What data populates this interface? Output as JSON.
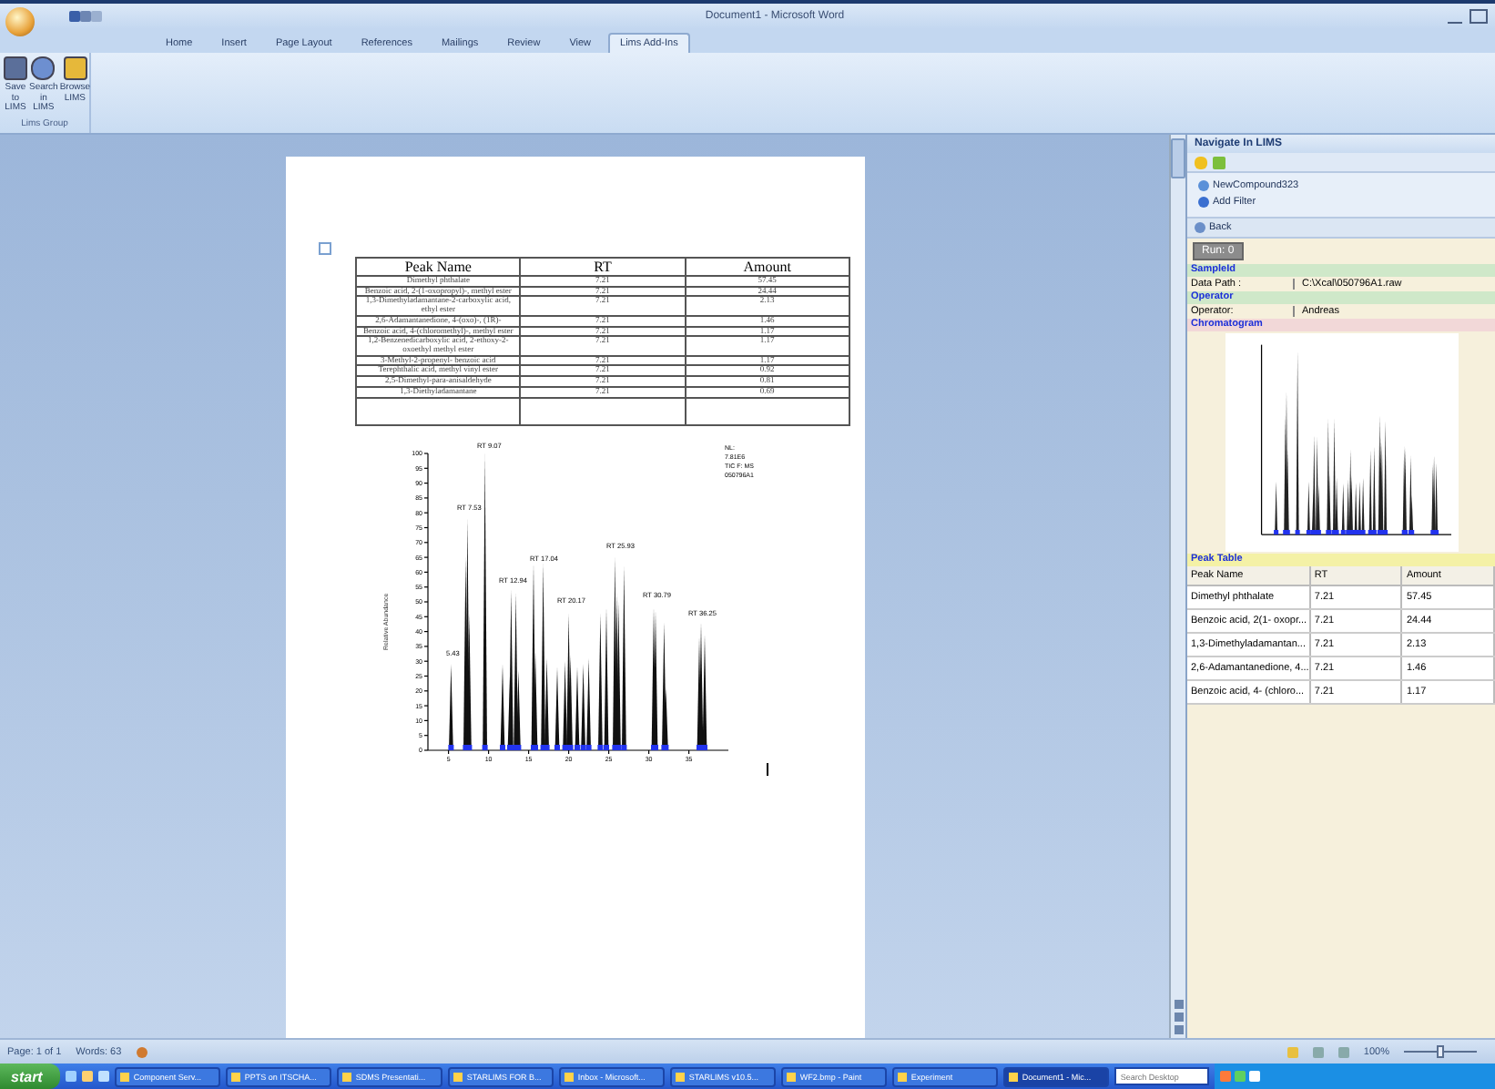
{
  "window": {
    "title": "Document1 - Microsoft Word"
  },
  "ribbon_tabs": [
    {
      "label": "Home",
      "selected": false
    },
    {
      "label": "Insert",
      "selected": false
    },
    {
      "label": "Page Layout",
      "selected": false
    },
    {
      "label": "References",
      "selected": false
    },
    {
      "label": "Mailings",
      "selected": false
    },
    {
      "label": "Review",
      "selected": false
    },
    {
      "label": "View",
      "selected": false
    },
    {
      "label": "Lims Add-Ins",
      "selected": true
    }
  ],
  "ribbon_group": {
    "label": "Lims Group",
    "buttons": [
      {
        "kind": "save",
        "label": "Save to LIMS"
      },
      {
        "kind": "search",
        "label": "Search in LIMS"
      },
      {
        "kind": "browse",
        "label": "Browse LIMS"
      }
    ]
  },
  "document": {
    "table": {
      "columns": [
        "Peak Name",
        "RT",
        "Amount"
      ],
      "rows": [
        {
          "name": "Dimethyl phthalate",
          "rt": "7.21",
          "amount": "57.45"
        },
        {
          "name": "Benzoic acid, 2-(1-oxopropyl)-, methyl ester",
          "rt": "7.21",
          "amount": "24.44"
        },
        {
          "name": "1,3-Dimethyladamantane-2-carboxylic acid, ethyl ester",
          "rt": "7.21",
          "amount": "2.13"
        },
        {
          "name": "2,6-Adamantanedione, 4-(oxo)-, (1R)-",
          "rt": "7.21",
          "amount": "1.46"
        },
        {
          "name": "Benzoic acid, 4-(chloromethyl)-, methyl ester",
          "rt": "7.21",
          "amount": "1.17"
        },
        {
          "name": "1,2-Benzenedicarboxylic acid, 2-ethoxy-2-oxoethyl methyl ester",
          "rt": "7.21",
          "amount": "1.17"
        },
        {
          "name": "3-Methyl-2-propenyl- benzoic acid",
          "rt": "7.21",
          "amount": "1.17"
        },
        {
          "name": "Terephthalic acid, methyl vinyl ester",
          "rt": "7.21",
          "amount": "0.92"
        },
        {
          "name": "2,5-Dimethyl-para-anisaldehyde",
          "rt": "7.21",
          "amount": "0.81"
        },
        {
          "name": "1,3-Diethyladamantane",
          "rt": "7.21",
          "amount": "0.69"
        }
      ]
    },
    "chromatogram": {
      "y_title": "Relative Abundance",
      "y_ticks": [
        "100",
        "95",
        "90",
        "85",
        "80",
        "75",
        "70",
        "65",
        "60",
        "55",
        "50",
        "45",
        "40",
        "35",
        "30",
        "25",
        "20",
        "15",
        "10",
        "5",
        "0"
      ],
      "x_ticks": [
        "5",
        "10",
        "15",
        "20",
        "25",
        "30",
        "35"
      ],
      "peak_labels": [
        "RT 9.07",
        "RT 7.53",
        "RT 12.94",
        "RT 17.04",
        "RT 20.17",
        "RT 25.93",
        "RT 30.79",
        "RT 36.25",
        "5.43"
      ],
      "legend": [
        "NL:",
        "7.81E6",
        "TIC F: MS",
        "050796A1"
      ]
    }
  },
  "panel": {
    "title": "Navigate In LIMS",
    "links": [
      "NewCompound323",
      "Add Filter"
    ],
    "back": "Back",
    "run": "Run: 0",
    "sections": [
      {
        "kind": "heading",
        "label": "SampleId",
        "color": "#cfe8c9"
      },
      {
        "kind": "property",
        "name": "Data Path :",
        "value": "C:\\Xcal\\050796A1.raw"
      },
      {
        "kind": "heading",
        "label": "Operator",
        "color": "#cfe8c9"
      },
      {
        "kind": "property",
        "name": "Operator:",
        "value": "Andreas"
      },
      {
        "kind": "heading",
        "label": "Chromatogram",
        "color": "#f2d8d8"
      },
      {
        "kind": "image"
      },
      {
        "kind": "heading",
        "label": "Peak Table",
        "color": "#f4f1a6"
      },
      {
        "kind": "table",
        "columns": [
          "Peak Name",
          "RT",
          "Amount"
        ],
        "rows": [
          [
            "Dimethyl phthalate",
            "7.21",
            "57.45"
          ],
          [
            "Benzoic acid, 2(1- oxopr...",
            "7.21",
            "24.44"
          ],
          [
            "1,3-Dimethyladamantan...",
            "7.21",
            "2.13"
          ],
          [
            "2,6-Adamantanedione, 4...",
            "7.21",
            "1.46"
          ],
          [
            "Benzoic acid, 4- (chloro...",
            "7.21",
            "1.17"
          ]
        ]
      }
    ]
  },
  "status_bar": {
    "page": "Page: 1 of 1",
    "words": "Words: 63",
    "zoom": "100%",
    "zoom_slider": {
      "level": 0.5
    }
  },
  "taskbar": {
    "start": "start",
    "items": [
      {
        "label": "Component Serv...",
        "selected": false
      },
      {
        "label": "PPTS on ITSCHA...",
        "selected": false
      },
      {
        "label": "SDMS Presentati...",
        "selected": false
      },
      {
        "label": "STARLIMS FOR B...",
        "selected": false
      },
      {
        "label": "Inbox - Microsoft...",
        "selected": false
      },
      {
        "label": "STARLIMS v10.5...",
        "selected": false
      },
      {
        "label": "WF2.bmp - Paint",
        "selected": false
      },
      {
        "label": "Experiment",
        "selected": false
      },
      {
        "label": "Document1 - Mic...",
        "selected": true
      }
    ],
    "search_placeholder": "Search Desktop"
  }
}
